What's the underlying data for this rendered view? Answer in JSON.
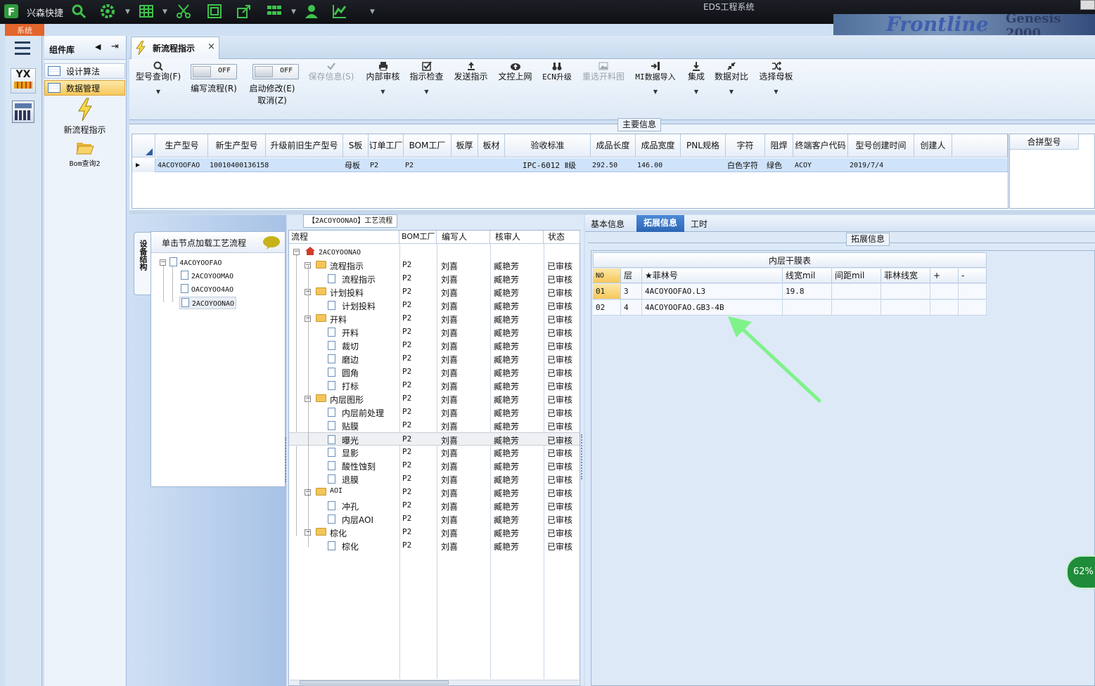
{
  "app": {
    "title": "EDS工程系统",
    "quick_access": "兴森快捷",
    "system_tab": "系统",
    "brand_graphic_text_1": "Frontline",
    "brand_graphic_text_2": "Genesis 2000"
  },
  "component_panel": {
    "title": "组件库",
    "items": [
      {
        "label": "设计算法"
      },
      {
        "label": "数据管理"
      }
    ],
    "launchers": [
      {
        "label": "新流程指示"
      },
      {
        "label": "Bom查询2"
      }
    ]
  },
  "left_strip": {
    "logo_text": "YX"
  },
  "document_tab": {
    "label": "新流程指示",
    "close": "×"
  },
  "toolbar": {
    "buttons": [
      {
        "label": "型号查询(F)"
      },
      {
        "label": "编写流程(R)"
      },
      {
        "label": "启动修改(E)"
      },
      {
        "label": "取消(Z)"
      },
      {
        "label": "保存信息(S)"
      },
      {
        "label": "内部审核"
      },
      {
        "label": "指示检查"
      },
      {
        "label": "发送指示"
      },
      {
        "label": "文控上网"
      },
      {
        "label": "ECN升级"
      },
      {
        "label": "重选开料图"
      },
      {
        "label": "MI数据导入"
      },
      {
        "label": "集成"
      },
      {
        "label": "数据对比"
      },
      {
        "label": "选择母板"
      }
    ],
    "toggle_text": "OFF"
  },
  "main_info": {
    "title": "主要信息",
    "columns": [
      "生产型号",
      "新生产型号",
      "升级前旧生产型号",
      "S板",
      "订单工厂",
      "BOM工厂",
      "板厚",
      "板材",
      "验收标准",
      "成品长度",
      "成品宽度",
      "PNL规格",
      "字符",
      "阻焊",
      "终端客户代码",
      "型号创建时间",
      "创建人"
    ],
    "row": [
      "4ACOYOOFAO",
      "10010400136158",
      "",
      "母板",
      "P2",
      "P2",
      "",
      "",
      "IPC-6012 Ⅱ级",
      "292.50",
      "146.00",
      "",
      "白色字符",
      "绿色",
      "ACOY",
      "2019/7/4",
      ""
    ],
    "merge_column": "合拼型号"
  },
  "structure_panel": {
    "vertical_tab": "设备结构",
    "hint": "单击节点加载工艺流程",
    "tree": {
      "root": "4ACOYOOFAO",
      "children": [
        "2ACOYOOMAO",
        "OACOYOO4AO",
        "2ACOYOONAO"
      ]
    }
  },
  "process_panel": {
    "title": "【2ACOYOONAO】工艺流程",
    "columns": [
      "流程",
      "BOM工厂",
      "编写人",
      "核审人",
      "状态"
    ],
    "root": "2ACOYOONAO",
    "rows": [
      {
        "name": "流程指示",
        "folder": true,
        "bom": "P2",
        "writer": "刘喜",
        "reviewer": "臧艳芳",
        "status": "已审核"
      },
      {
        "name": "流程指示",
        "folder": false,
        "bom": "P2",
        "writer": "刘喜",
        "reviewer": "臧艳芳",
        "status": "已审核"
      },
      {
        "name": "计划投料",
        "folder": true,
        "bom": "P2",
        "writer": "刘喜",
        "reviewer": "臧艳芳",
        "status": "已审核"
      },
      {
        "name": "计划投料",
        "folder": false,
        "bom": "P2",
        "writer": "刘喜",
        "reviewer": "臧艳芳",
        "status": "已审核"
      },
      {
        "name": "开料",
        "folder": true,
        "bom": "P2",
        "writer": "刘喜",
        "reviewer": "臧艳芳",
        "status": "已审核"
      },
      {
        "name": "开料",
        "folder": false,
        "bom": "P2",
        "writer": "刘喜",
        "reviewer": "臧艳芳",
        "status": "已审核"
      },
      {
        "name": "裁切",
        "folder": false,
        "bom": "P2",
        "writer": "刘喜",
        "reviewer": "臧艳芳",
        "status": "已审核"
      },
      {
        "name": "磨边",
        "folder": false,
        "bom": "P2",
        "writer": "刘喜",
        "reviewer": "臧艳芳",
        "status": "已审核"
      },
      {
        "name": "圆角",
        "folder": false,
        "bom": "P2",
        "writer": "刘喜",
        "reviewer": "臧艳芳",
        "status": "已审核"
      },
      {
        "name": "打标",
        "folder": false,
        "bom": "P2",
        "writer": "刘喜",
        "reviewer": "臧艳芳",
        "status": "已审核"
      },
      {
        "name": "内层图形",
        "folder": true,
        "bom": "P2",
        "writer": "刘喜",
        "reviewer": "臧艳芳",
        "status": "已审核"
      },
      {
        "name": "内层前处理",
        "folder": false,
        "bom": "P2",
        "writer": "刘喜",
        "reviewer": "臧艳芳",
        "status": "已审核"
      },
      {
        "name": "贴膜",
        "folder": false,
        "bom": "P2",
        "writer": "刘喜",
        "reviewer": "臧艳芳",
        "status": "已审核"
      },
      {
        "name": "曝光",
        "folder": false,
        "bom": "P2",
        "writer": "刘喜",
        "reviewer": "臧艳芳",
        "status": "已审核",
        "selected": true
      },
      {
        "name": "显影",
        "folder": false,
        "bom": "P2",
        "writer": "刘喜",
        "reviewer": "臧艳芳",
        "status": "已审核"
      },
      {
        "name": "酸性蚀刻",
        "folder": false,
        "bom": "P2",
        "writer": "刘喜",
        "reviewer": "臧艳芳",
        "status": "已审核"
      },
      {
        "name": "退膜",
        "folder": false,
        "bom": "P2",
        "writer": "刘喜",
        "reviewer": "臧艳芳",
        "status": "已审核"
      },
      {
        "name": "AOI",
        "folder": true,
        "bom": "P2",
        "writer": "刘喜",
        "reviewer": "臧艳芳",
        "status": "已审核"
      },
      {
        "name": "冲孔",
        "folder": false,
        "bom": "P2",
        "writer": "刘喜",
        "reviewer": "臧艳芳",
        "status": "已审核"
      },
      {
        "name": "内层AOI",
        "folder": false,
        "bom": "P2",
        "writer": "刘喜",
        "reviewer": "臧艳芳",
        "status": "已审核"
      },
      {
        "name": "棕化",
        "folder": true,
        "bom": "P2",
        "writer": "刘喜",
        "reviewer": "臧艳芳",
        "status": "已审核"
      },
      {
        "name": "棕化",
        "folder": false,
        "bom": "P2",
        "writer": "刘喜",
        "reviewer": "臧艳芳",
        "status": "已审核"
      }
    ]
  },
  "detail_panel": {
    "tabs": [
      "基本信息",
      "拓展信息",
      "工时"
    ],
    "active_tab": "拓展信息",
    "group_title": "拓展信息",
    "table_title": "内层干膜表",
    "columns": [
      "NO",
      "层",
      "★菲林号",
      "线宽mil",
      "间距mil",
      "菲林线宽",
      "+",
      "-"
    ],
    "rows": [
      [
        "01",
        "3",
        "4ACOYOOFAO.L3",
        "19.8",
        "",
        "",
        "",
        ""
      ],
      [
        "02",
        "4",
        "4ACOYOOFAO.GB3-4B",
        "",
        "",
        "",
        "",
        ""
      ]
    ]
  },
  "progress_badge": {
    "text": "62%",
    "value": 62
  },
  "colors": {
    "accent_orange": "#e2652b",
    "selection_blue": "#cfe3fa",
    "annotation_arrow": "#7ff28a",
    "badge_green": "#2cae4a"
  }
}
